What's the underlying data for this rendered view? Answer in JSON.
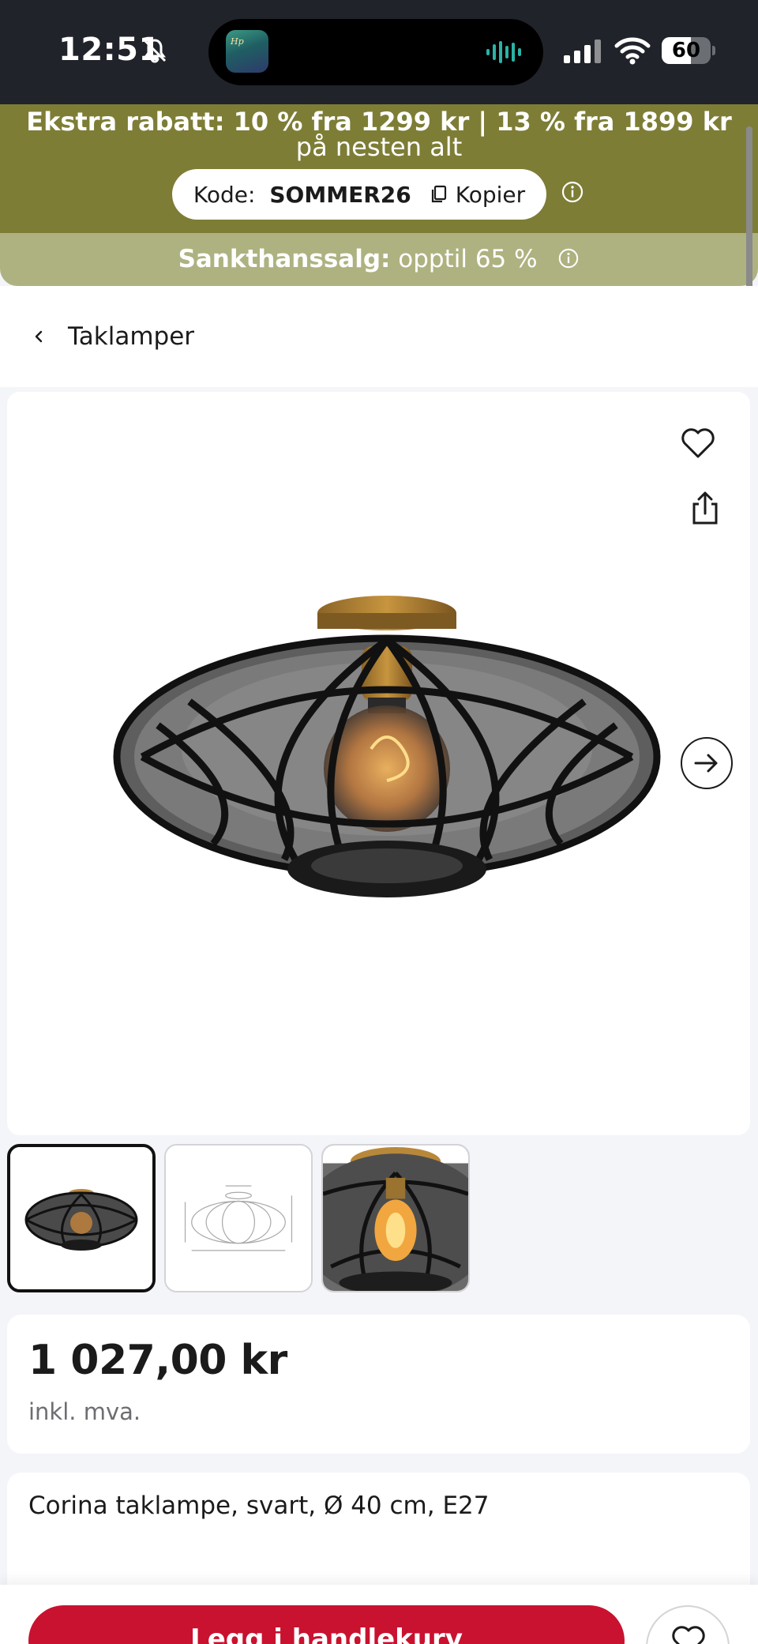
{
  "status_bar": {
    "time": "12:51",
    "battery_level": "60",
    "battery_fraction": 0.6,
    "icons": [
      "bell-slash-icon",
      "signal-icon",
      "wifi-icon",
      "battery-icon"
    ]
  },
  "promo": {
    "bold_text": "Ekstra rabatt: 10 % fra 1299 kr | 13 % fra 1899 kr",
    "normal_text": " på nesten alt",
    "code_label": "Kode:",
    "code_value": "SOMMER26",
    "copy_label": "Kopier",
    "sale_bold": "Sankthanssalg:",
    "sale_text": " opptil 65 %"
  },
  "breadcrumb": {
    "label": "Taklamper"
  },
  "product": {
    "price": "1 027,00 kr",
    "vat_note": "inkl. mva.",
    "title": "Corina taklampe, svart, Ø 40 cm, E27",
    "thumbnails": [
      "lamp-front",
      "lamp-dimensions",
      "lamp-closeup"
    ]
  },
  "actions": {
    "add_to_cart": "Legg i handlekurv"
  },
  "colors": {
    "promo_primary": "#7d7d36",
    "promo_secondary": "#aeb280",
    "cta_red": "#c81230",
    "status_bar": "#20232a"
  }
}
